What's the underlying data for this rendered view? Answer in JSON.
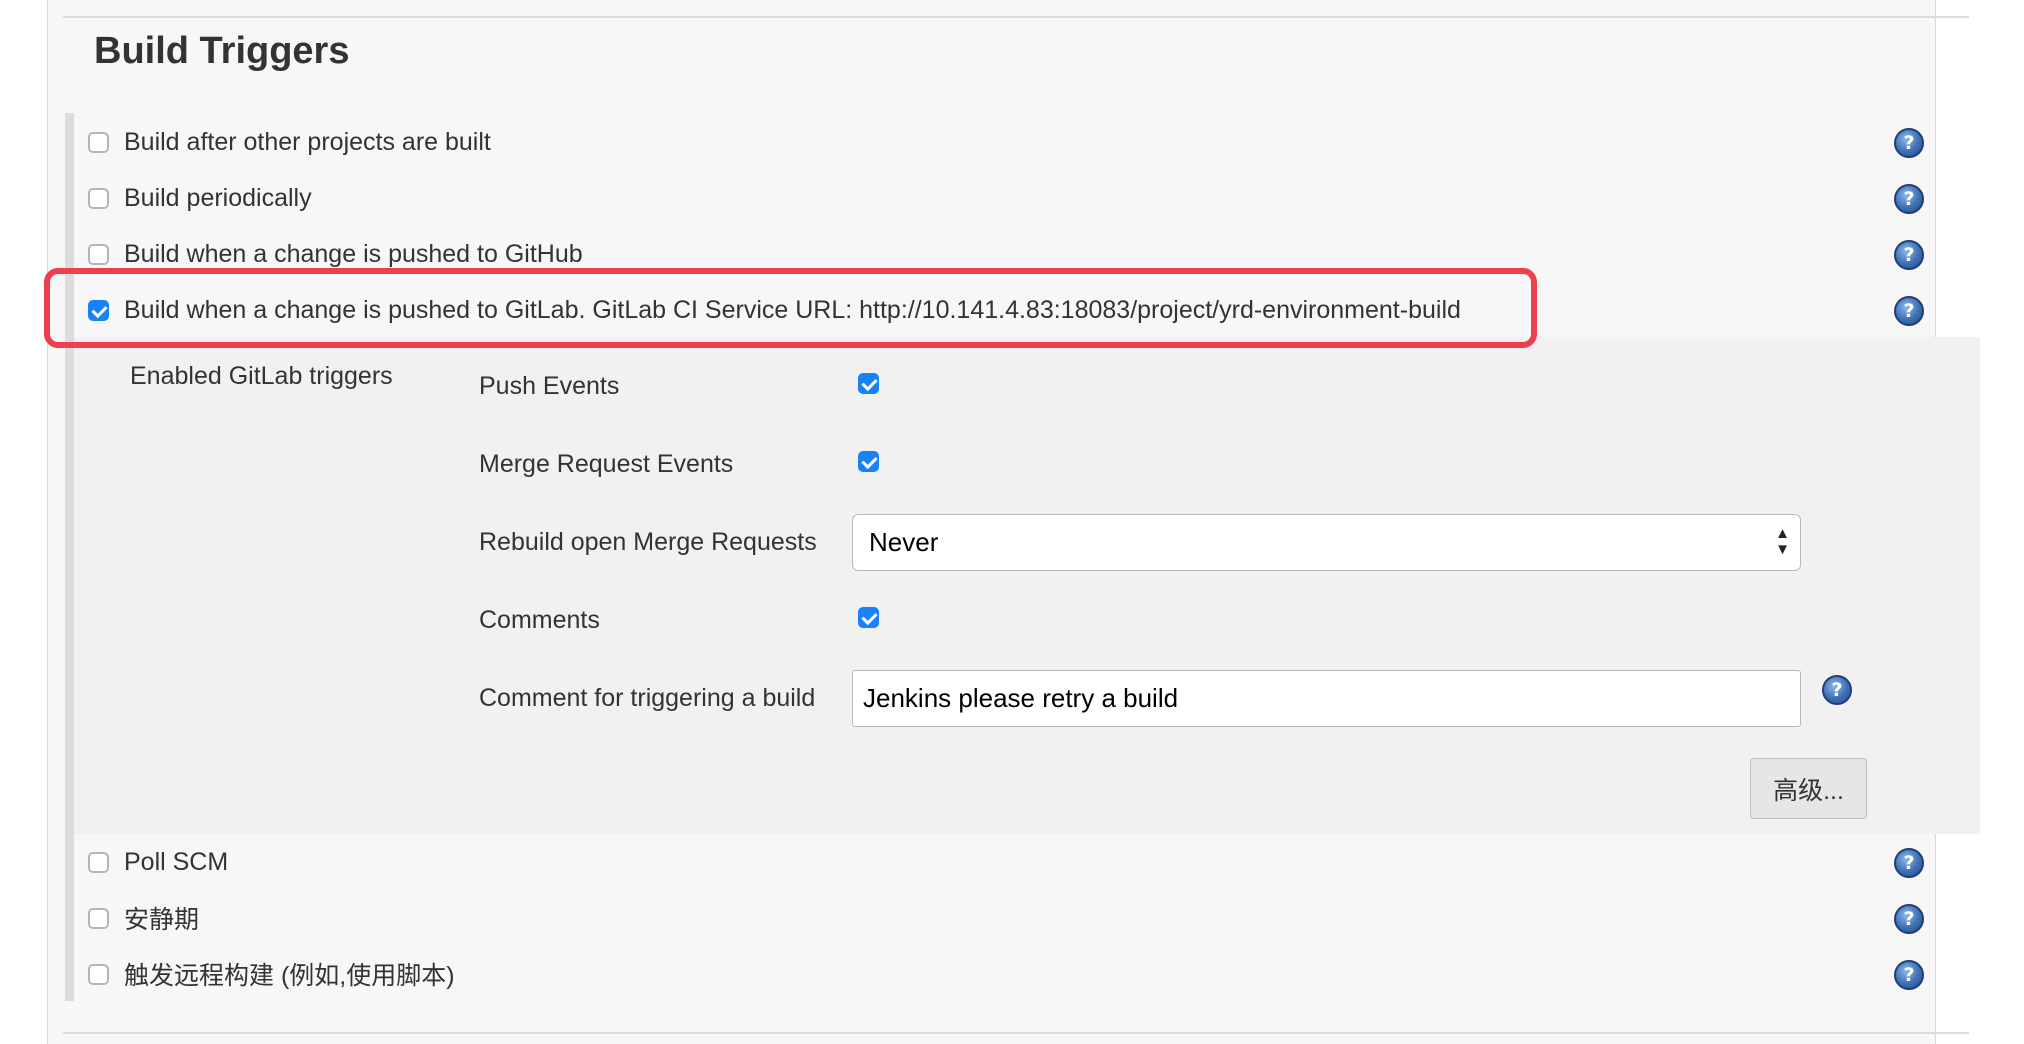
{
  "section": {
    "title": "Build Triggers"
  },
  "triggers": [
    {
      "label": "Build after other projects are built",
      "checked": false
    },
    {
      "label": "Build periodically",
      "checked": false
    },
    {
      "label": "Build when a change is pushed to GitHub",
      "checked": false
    },
    {
      "label": "Build when a change is pushed to GitLab. GitLab CI Service URL: http://10.141.4.83:18083/project/yrd-environment-build",
      "checked": true
    },
    {
      "label": "Poll SCM",
      "checked": false
    },
    {
      "label": "安静期",
      "checked": false
    },
    {
      "label": "触发远程构建 (例如,使用脚本)",
      "checked": false
    }
  ],
  "gitlab": {
    "section_label": "Enabled GitLab triggers",
    "push_events": {
      "label": "Push Events",
      "checked": true
    },
    "merge_request_events": {
      "label": "Merge Request Events",
      "checked": true
    },
    "rebuild_open_mr": {
      "label": "Rebuild open Merge Requests",
      "value": "Never"
    },
    "comments": {
      "label": "Comments",
      "checked": true
    },
    "comment_trigger": {
      "label": "Comment for triggering a build",
      "value": "Jenkins please retry a build"
    },
    "advanced_button": "高级..."
  },
  "icons": {
    "help": "help-icon",
    "help_glyph": "?",
    "select_arrows": "▲▼"
  },
  "colors": {
    "highlight": "#ef3f4f",
    "checkbox_checked": "#1a82f7",
    "help_icon": "#3d6fb5"
  }
}
